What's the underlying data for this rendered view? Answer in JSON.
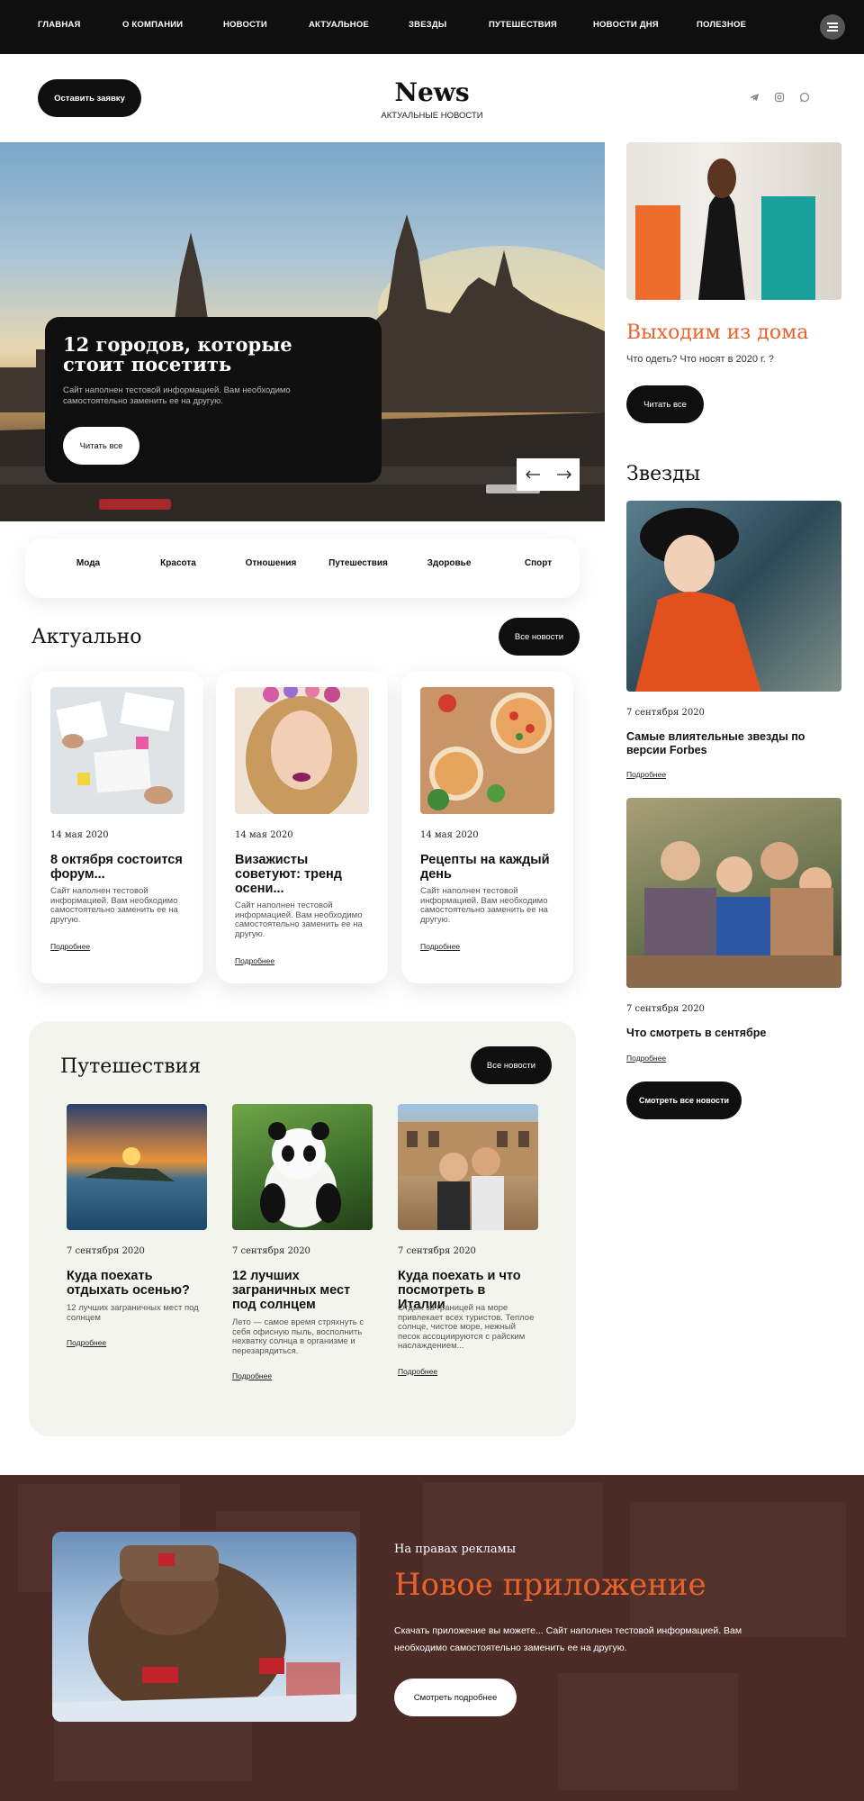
{
  "nav": {
    "items": [
      "ГЛАВНАЯ",
      "О КОМПАНИИ",
      "НОВОСТИ",
      "АКТУАЛЬНОЕ",
      "ЗВЕЗДЫ",
      "ПУТЕШЕСТВИЯ",
      "НОВОСТИ ДНЯ",
      "ПОЛЕЗНОЕ"
    ],
    "menu_icon": "menu-icon"
  },
  "header": {
    "request_button": "Оставить заявку",
    "logo": "News",
    "tagline": "АКТУАЛЬНЫЕ НОВОСТИ",
    "social_icons": [
      "telegram-icon",
      "instagram-icon",
      "whatsapp-icon"
    ]
  },
  "hero": {
    "title": "12 городов, которые стоит посетить",
    "description": "Сайт наполнен тестовой информацией. Вам необходимо самостоятельно заменить ее на другую.",
    "button": "Читать все",
    "prev_icon": "arrow-left-icon",
    "next_icon": "arrow-right-icon"
  },
  "sidebar": {
    "promo_title": "Выходим из дома",
    "promo_subtitle": "Что одеть? Что носят в 2020 г. ?",
    "promo_button": "Читать все",
    "stars_heading": "Звезды",
    "stars": [
      {
        "date": "7 сентября 2020",
        "title": "Самые влиятельные звезды по версии Forbes",
        "more": "Подробнее"
      },
      {
        "date": "7 сентября 2020",
        "title": "Что смотреть в сентябре",
        "more": "Подробнее"
      }
    ],
    "all_button": "Смотреть все новости"
  },
  "categories": [
    "Мода",
    "Красота",
    "Отношения",
    "Путешествия",
    "Здоровье",
    "Спорт"
  ],
  "actual": {
    "heading": "Актуально",
    "all_button": "Все новости",
    "cards": [
      {
        "date": "14 мая 2020",
        "title": "8 октября состоится форум...",
        "desc": "Сайт наполнен тестовой информацией. Вам необходимо самостоятельно заменить ее на другую.",
        "more": "Подробнее"
      },
      {
        "date": "14 мая 2020",
        "title": "Визажисты советуют: тренд осени...",
        "desc": "Сайт наполнен тестовой информацией. Вам необходимо самостоятельно заменить ее на другую.",
        "more": "Подробнее"
      },
      {
        "date": "14 мая 2020",
        "title": "Рецепты на каждый день",
        "desc": "Сайт наполнен тестовой информацией. Вам необходимо самостоятельно заменить ее на другую.",
        "more": "Подробнее"
      }
    ]
  },
  "travel": {
    "heading": "Путешествия",
    "all_button": "Все новости",
    "cards": [
      {
        "date": "7 сентября 2020",
        "title": "Куда поехать отдыхать осенью?",
        "desc": "12 лучших заграничных мест под солнцем",
        "more": "Подробнее"
      },
      {
        "date": "7 сентября 2020",
        "title": "12 лучших заграничных мест под солнцем",
        "desc": "Лето — самое время стряхнуть с себя офисную пыль, восполнить нехватку солнца в организме и перезарядиться.",
        "more": "Подробнее"
      },
      {
        "date": "7 сентября 2020",
        "title": "Куда поехать и что посмотреть в Италии",
        "desc": "Отдых за границей на море привлекает всех туристов. Теплое солнце, чистое море, нежный песок ассоциируются с райским наслаждением...",
        "more": "Подробнее"
      }
    ]
  },
  "ad": {
    "label": "На правах рекламы",
    "title": "Новое приложение",
    "description": "Скачать приложение вы можете... Сайт наполнен тестовой информацией. Вам необходимо самостоятельно заменить ее на другую.",
    "button": "Смотреть подробнее"
  },
  "colors": {
    "accent": "#e8632c",
    "dark": "#0f0f0f",
    "ad_background": "#4c2a25"
  }
}
